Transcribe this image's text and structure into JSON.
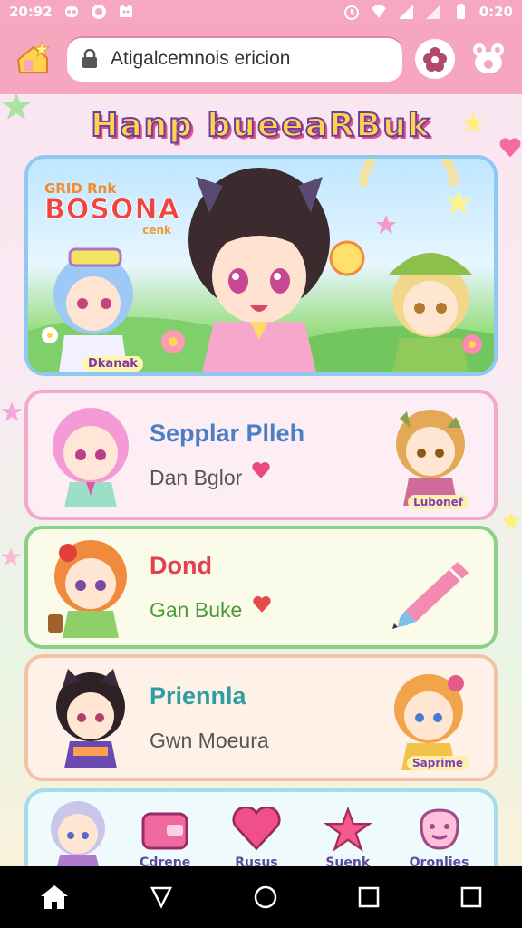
{
  "status_bar": {
    "time_left": "20:92",
    "time_right": "0:20"
  },
  "url_bar": {
    "text": "Atigalcemnois ericion"
  },
  "page_title": "Hanp bueeaRBuk",
  "hero": {
    "logo_small": "GRID Rnk",
    "logo_main": "BOSONA",
    "logo_sub": "cenk",
    "badge": "Dkanak"
  },
  "cards": [
    {
      "title": "Sepplar Plleh",
      "subtitle": "Dan Bglor",
      "title_color": "#4a7fc6",
      "badge": "Lubonef"
    },
    {
      "title": "Dond",
      "subtitle": "Gan Buke",
      "title_color": "#e0404f",
      "badge": ""
    },
    {
      "title": "Priennla",
      "subtitle": "Gwn Moeura",
      "title_color": "#2f9e9e",
      "badge": "Saprime"
    }
  ],
  "dock": {
    "items": [
      {
        "label": "Cdrene",
        "icon": "wallet-icon"
      },
      {
        "label": "Rusus",
        "icon": "heart-icon"
      },
      {
        "label": "Suenk",
        "icon": "star-icon"
      },
      {
        "label": "Oronlies",
        "icon": "smile-icon"
      }
    ]
  },
  "colors": {
    "accent": "#f7a6c0",
    "hero_border": "#8fc8f0",
    "card1_border": "#f2a9cb",
    "card2_border": "#8dcf87",
    "card3_border": "#f3c3a8"
  }
}
